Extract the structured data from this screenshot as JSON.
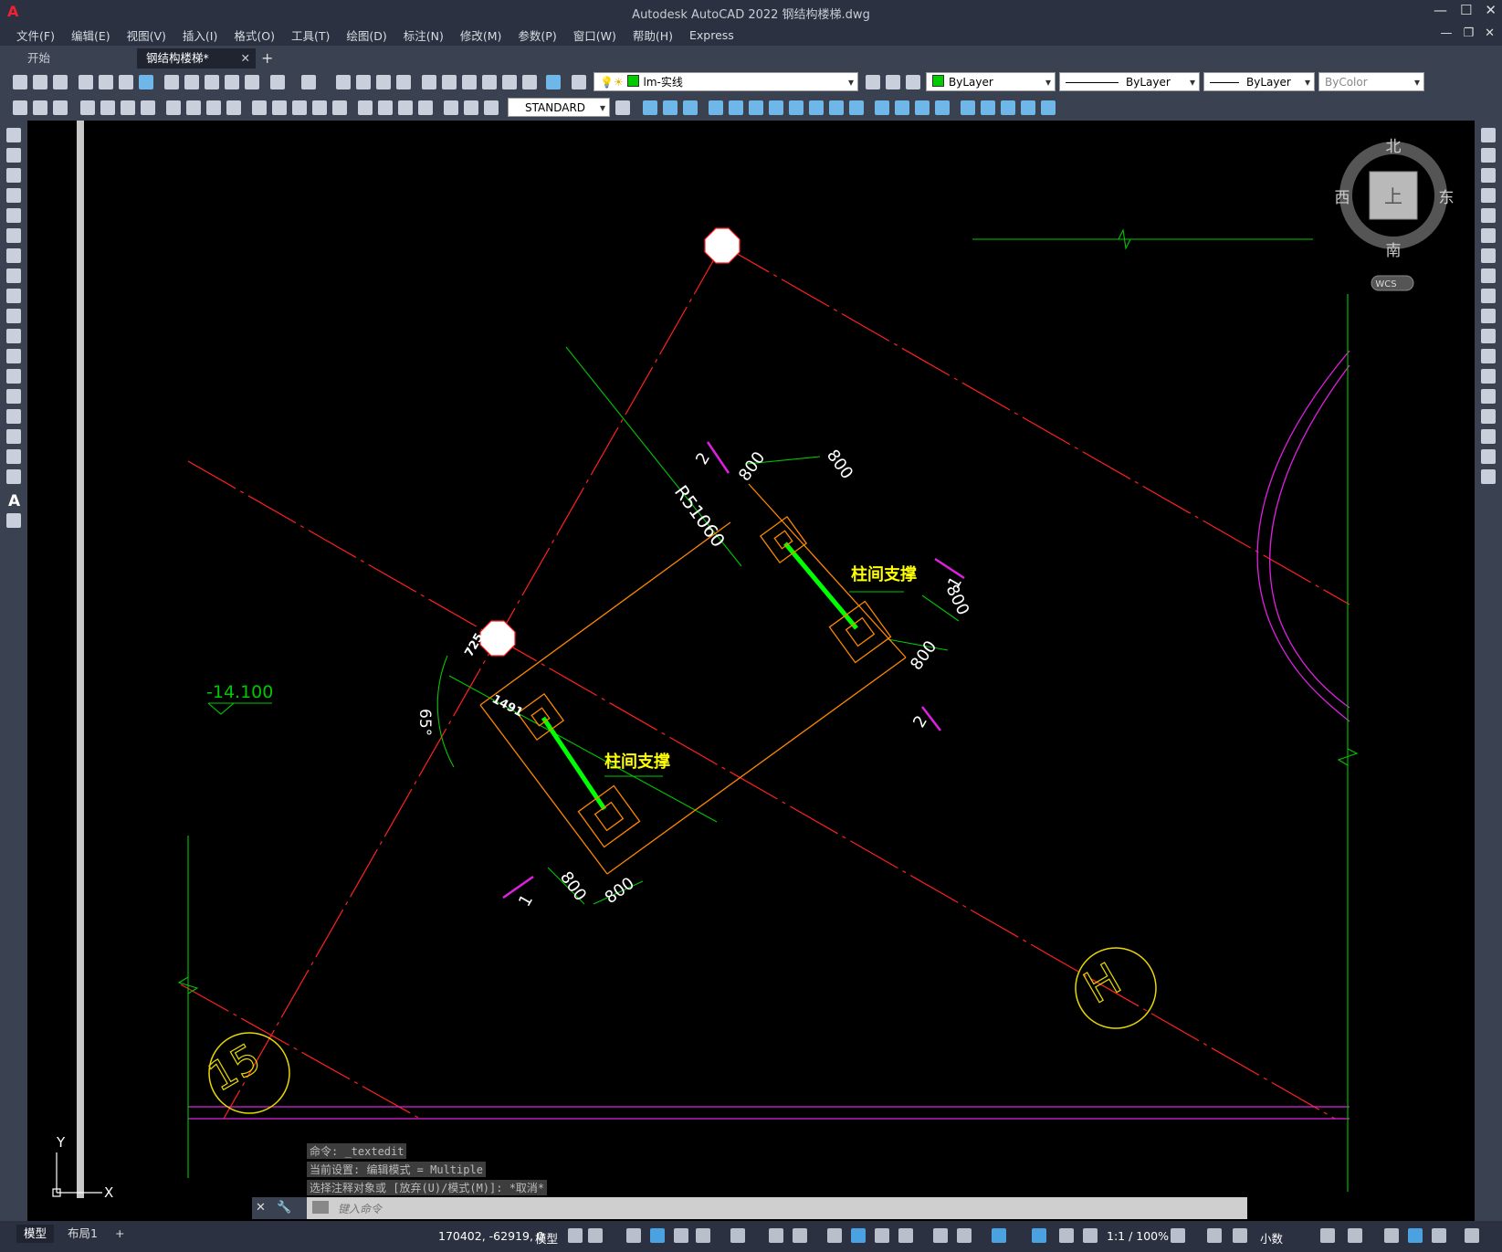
{
  "app": {
    "logo": "A",
    "title": "Autodesk AutoCAD 2022    钢结构楼梯.dwg",
    "win_min": "—",
    "win_max": "☐",
    "win_close": "✕"
  },
  "menu": {
    "items": [
      "文件(F)",
      "编辑(E)",
      "视图(V)",
      "插入(I)",
      "格式(O)",
      "工具(T)",
      "绘图(D)",
      "标注(N)",
      "修改(M)",
      "参数(P)",
      "窗口(W)",
      "帮助(H)",
      "Express"
    ],
    "mdi_min": "—",
    "mdi_restore": "❐",
    "mdi_close": "✕"
  },
  "tabs": {
    "start": "开始",
    "active": "钢结构楼梯*",
    "close": "✕",
    "add": "+"
  },
  "toolbar": {
    "layer": "lm-实线",
    "color": "ByLayer",
    "linetype": "ByLayer",
    "lineweight": "ByLayer",
    "plotstyle": "ByColor",
    "textstyle": "STANDARD",
    "layer_color": "#00cc00"
  },
  "viewcube": {
    "north": "北",
    "south": "南",
    "east": "东",
    "west": "西",
    "top": "上",
    "wcs": "WCS"
  },
  "drawing": {
    "level": "-14.100",
    "radius": "R51060",
    "brace_label_1": "柱间支撑",
    "brace_label_2": "柱间支撑",
    "dims": [
      "800",
      "800",
      "800",
      "800",
      "800",
      "800"
    ],
    "dim_725": "725",
    "dim_1491": "1491",
    "angle": "65°",
    "sec_2a": "2",
    "sec_1a": "1",
    "sec_2b": "2",
    "sec_1b": "1",
    "axis_h": "H",
    "axis_15": "15",
    "ucs_x": "X",
    "ucs_y": "Y"
  },
  "command": {
    "history": [
      "命令: _textedit",
      "当前设置: 编辑模式 = Multiple",
      "选择注释对象或 [放弃(U)/模式(M)]: *取消*"
    ],
    "placeholder": "键入命令",
    "close": "✕"
  },
  "status": {
    "layout_model": "模型",
    "layout_1": "布局1",
    "add_layout": "+",
    "coords": "170402, -62919, 0",
    "space": "模型",
    "scale": "1:1 / 100%",
    "units": "小数"
  }
}
